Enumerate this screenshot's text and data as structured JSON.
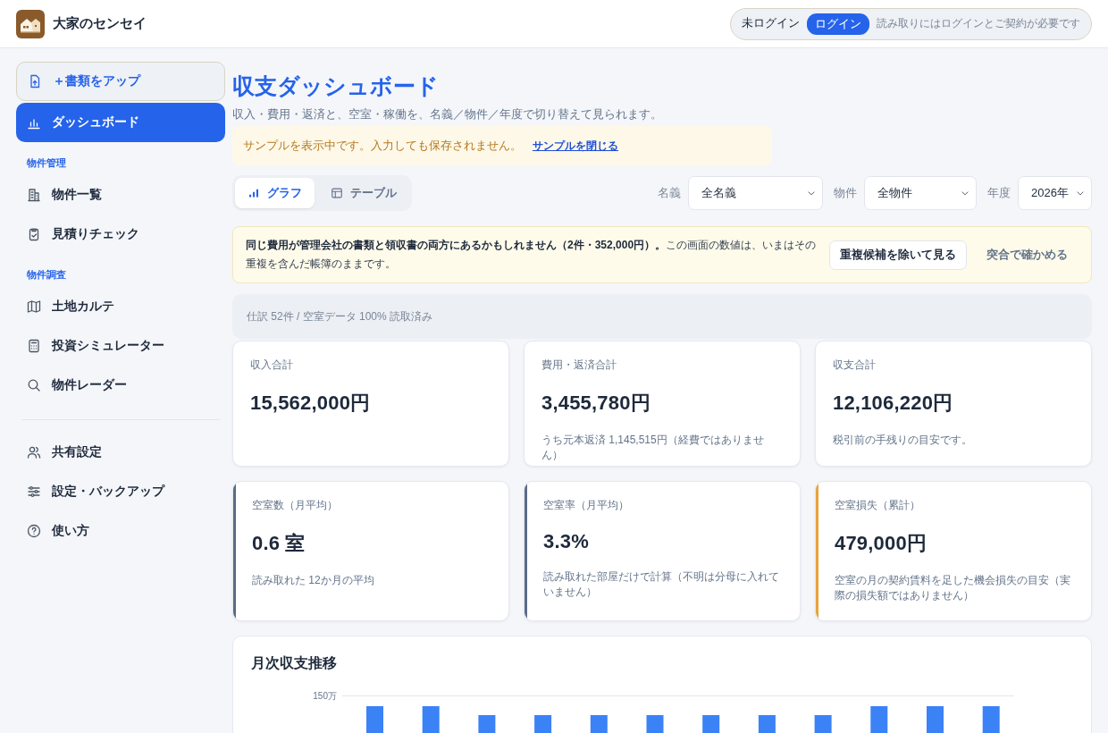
{
  "app": {
    "name": "大家のセンセイ"
  },
  "account": {
    "status": "未ログイン",
    "login_button": "ログイン",
    "note": "読み取りにはログインとご契約が必要です"
  },
  "sidebar": {
    "items": [
      {
        "kind": "upload",
        "label": "＋書類をアップ",
        "selected": false
      },
      {
        "kind": "link",
        "label": "ダッシュボード",
        "selected": true
      }
    ],
    "sections": [
      {
        "heading": "物件管理",
        "items": [
          {
            "label": "物件一覧",
            "selected": false
          },
          {
            "label": "見積りチェック",
            "selected": false
          }
        ]
      },
      {
        "heading": "物件調査",
        "items": [
          {
            "label": "土地カルテ",
            "selected": false
          },
          {
            "label": "投資シミュレーター",
            "selected": false
          },
          {
            "label": "物件レーダー",
            "selected": false
          }
        ]
      }
    ],
    "footer_items": [
      {
        "label": "共有設定",
        "selected": false
      },
      {
        "label": "設定・バックアップ",
        "selected": false
      },
      {
        "label": "使い方",
        "selected": false
      }
    ]
  },
  "page": {
    "title": "収支ダッシュボード",
    "subtitle": "収入・費用・返済と、空室・稼働を、名義／物件／年度で切り替えて見られます。",
    "sample_notice": {
      "text": "サンプルを表示中です。入力しても保存されません。",
      "link": "サンプルを閉じる"
    },
    "view_tabs": [
      {
        "label": "グラフ",
        "selected": true
      },
      {
        "label": "テーブル",
        "selected": false
      }
    ],
    "filters": [
      {
        "label": "名義",
        "value": "全名義"
      },
      {
        "label": "物件",
        "value": "全物件"
      },
      {
        "label": "年度",
        "value": "2026年"
      }
    ],
    "duplicate_warning": {
      "text": "**同じ費用が管理会社の書類と領収書の両方にあるかもしれません（2件・352,000円）。**この画面の数値は、いまはその重複を含んだ帳簿のままです。",
      "buttons": [
        {
          "kind": "outline",
          "label": "重複候補を除いて見る"
        },
        {
          "kind": "text",
          "label": "突合で確かめる"
        }
      ]
    },
    "status_line": "仕訳 52件 / 空室データ 100% 読取済み",
    "kpis": [
      {
        "label": "収入合計",
        "value": "15,562,000円"
      },
      {
        "label": "費用・返済合計",
        "value": "3,455,780円",
        "note": "うち元本返済 1,145,515円（経費ではありません）"
      },
      {
        "label": "収支合計",
        "value": "12,106,220円",
        "note": "税引前の手残りの目安です。"
      },
      {
        "label": "空室数（月平均）",
        "value": "0.6 室",
        "note": "読み取れた 12か月の平均",
        "color": "#5b6b85"
      },
      {
        "label": "空室率（月平均）",
        "value": "3.3%",
        "note": "読み取れた部屋だけで計算（不明は分母に入れていません）",
        "color": "#5b6b85"
      },
      {
        "label": "空室損失（累計）",
        "value": "479,000円",
        "note": "空室の月の契約賃料を足した機会損失の目安（実際の損失額ではありません）",
        "color": "#e9a23b"
      }
    ],
    "chart": {
      "title": "月次収支推移",
      "tick": "150万"
    }
  }
}
